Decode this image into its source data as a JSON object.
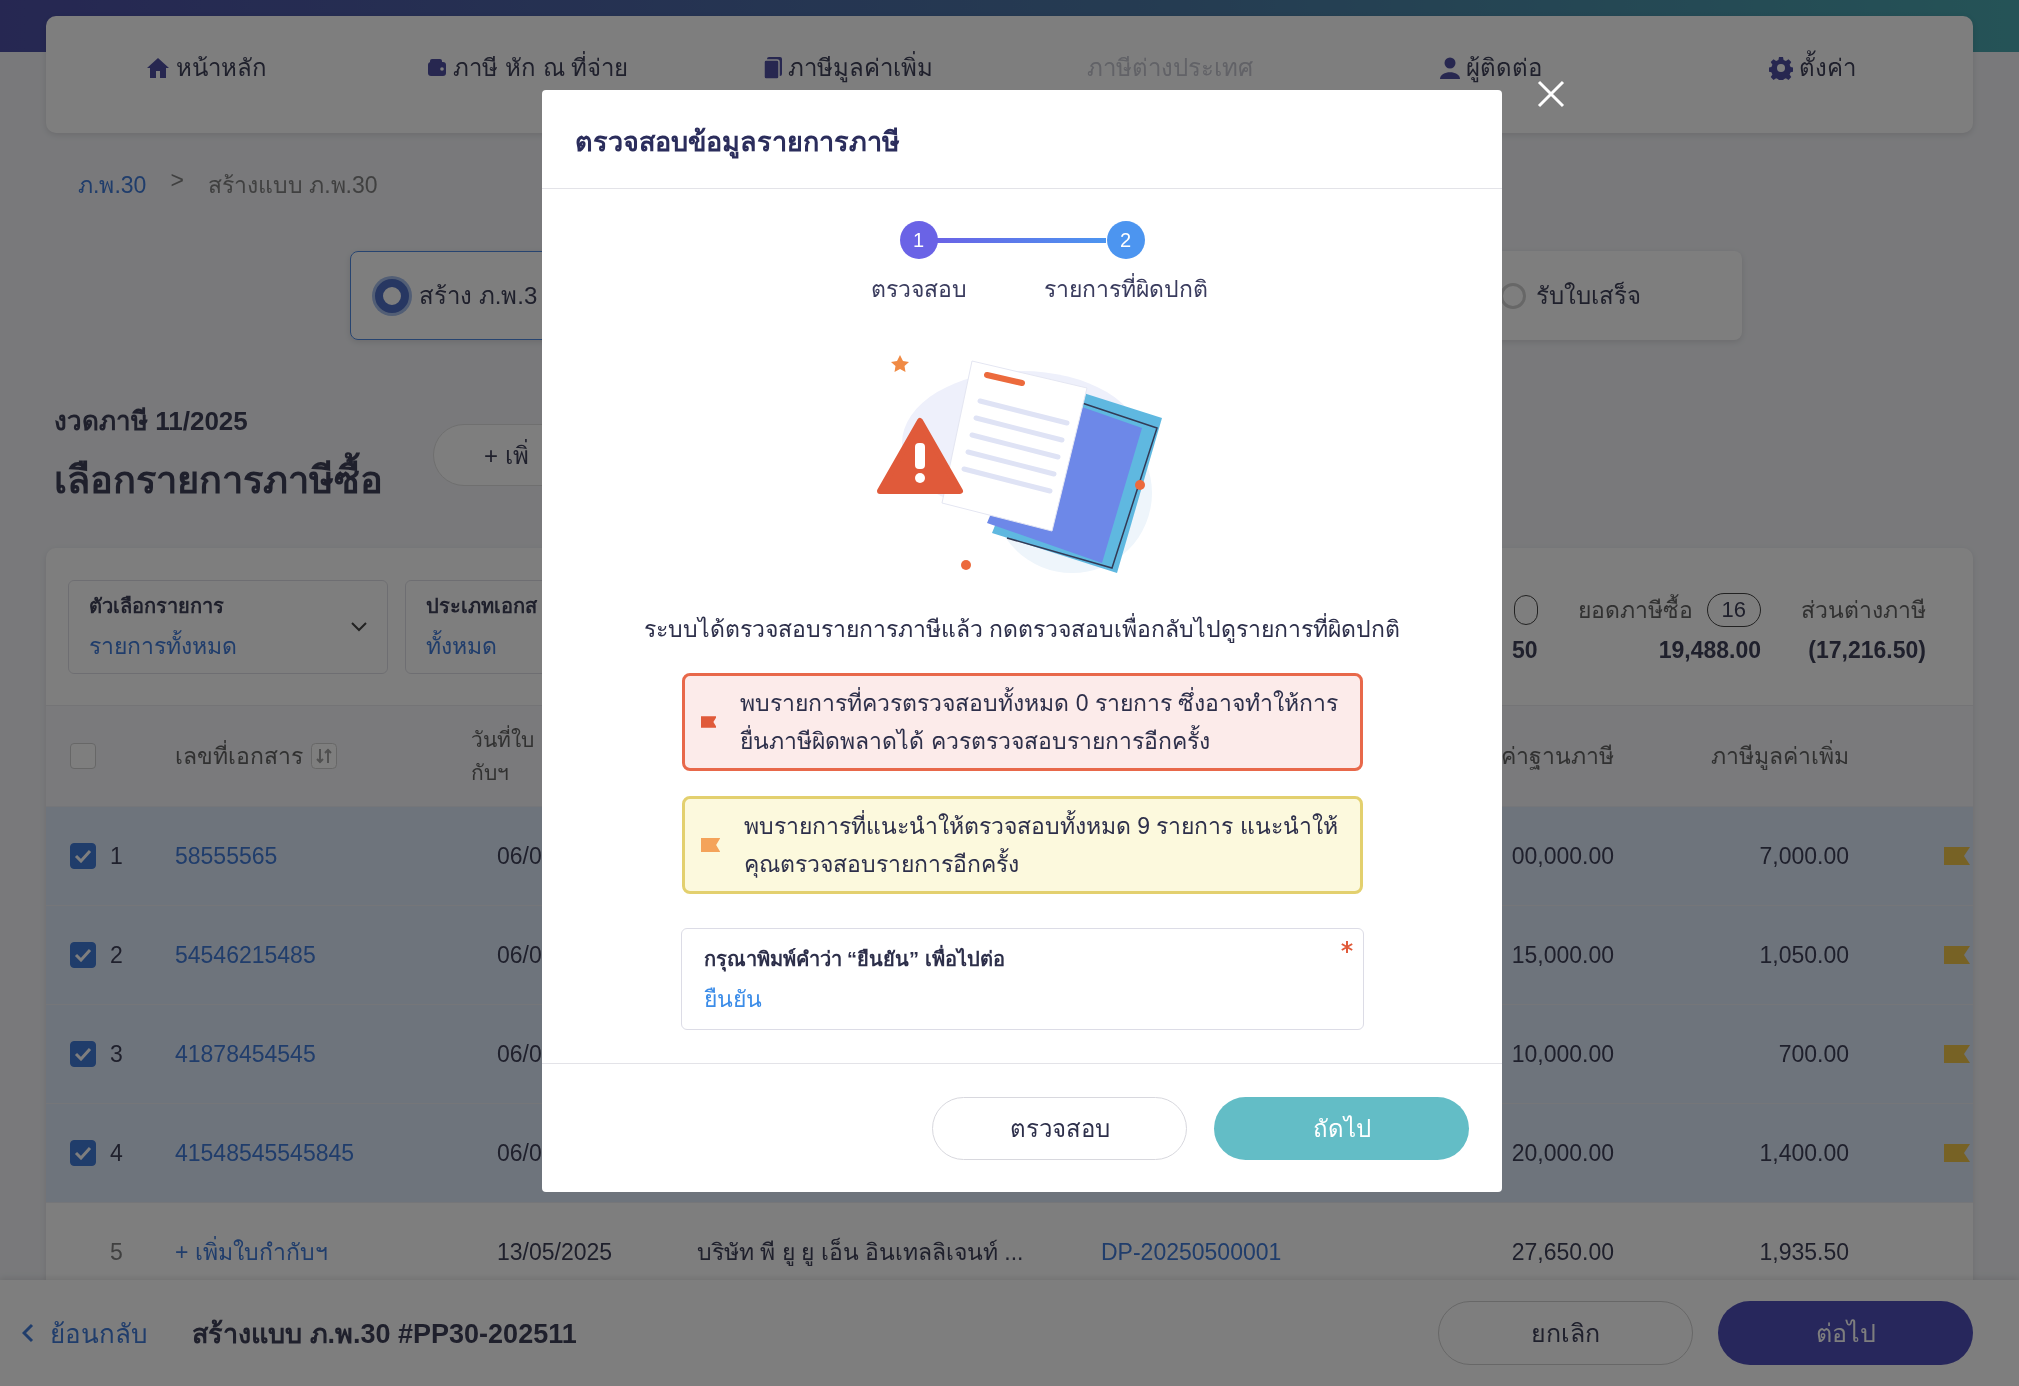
{
  "nav": [
    {
      "label": "หน้าหลัก",
      "kind": "home",
      "disabled": false
    },
    {
      "label": "ภาษี หัก ณ ที่จ่าย",
      "kind": "wallet",
      "disabled": false
    },
    {
      "label": "ภาษีมูลค่าเพิ่ม",
      "kind": "document",
      "disabled": false
    },
    {
      "label": "ภาษีต่างประเทศ",
      "kind": "none",
      "disabled": true
    },
    {
      "label": "ผู้ติดต่อ",
      "kind": "user",
      "disabled": false
    },
    {
      "label": "ตั้งค่า",
      "kind": "gear",
      "disabled": false
    }
  ],
  "breadcrumb": {
    "link": "ภ.พ.30",
    "separator": ">",
    "current": "สร้างแบบ ภ.พ.30"
  },
  "steps": [
    {
      "label": "สร้าง ภ.พ.3",
      "selected": true
    },
    {
      "label": "รับใบเสร็จ",
      "selected": false
    }
  ],
  "period": "งวดภาษี 11/2025",
  "heading": "เลือกรายการภาษีซื้อ",
  "add_button": "+ เพิ่",
  "filters": [
    {
      "label": "ตัวเลือกรายการ",
      "value": "รายการทั้งหมด",
      "kind": "select"
    },
    {
      "label": "ประเภทเอกส",
      "value": "ทั้งหมด",
      "kind": "text"
    }
  ],
  "summary": [
    {
      "value": "50",
      "badge": true
    },
    {
      "label": "ยอดภาษีซื้อ",
      "count": "16",
      "value": "19,488.00"
    },
    {
      "label": "ส่วนต่างภาษี",
      "value": "(17,216.50)"
    }
  ],
  "table": {
    "columns": [
      {
        "label": "เลขที่เอกสาร",
        "kind": "doc",
        "sortable": true
      },
      {
        "label": "วันที่ใบ กับฯ",
        "kind": "date",
        "sortable": false
      },
      {
        "label": "ค่าฐานภาษี",
        "kind": "base",
        "sortable": false
      },
      {
        "label": "ภาษีมูลค่าเพิ่ม",
        "kind": "vat",
        "sortable": false
      }
    ],
    "all_checked": false,
    "rows": [
      {
        "index": "1",
        "doc": "58555565",
        "date": "06/0",
        "base": "00,000.00",
        "vat": "7,000.00",
        "checked": true,
        "flag": true
      },
      {
        "index": "2",
        "doc": "54546215485",
        "date": "06/0",
        "base": "15,000.00",
        "vat": "1,050.00",
        "checked": true,
        "flag": true
      },
      {
        "index": "3",
        "doc": "41878454545",
        "date": "06/0",
        "base": "10,000.00",
        "vat": "700.00",
        "checked": true,
        "flag": true
      },
      {
        "index": "4",
        "doc": "41548545545845",
        "date": "06/0",
        "base": "20,000.00",
        "vat": "1,400.00",
        "checked": true,
        "flag": true
      },
      {
        "index": "5",
        "doc": "+ เพิ่มใบกำกับฯ",
        "date": "13/05/2025",
        "company": "บริษัท พี ยู ยู เอ็น อินเทลลิเจนท์ ...",
        "ref": "DP-20250500001",
        "base": "27,650.00",
        "vat": "1,935.50",
        "flag": false
      }
    ]
  },
  "footer": {
    "back": "ย้อนกลับ",
    "title": "สร้างแบบ ภ.พ.30 #PP30-202511",
    "cancel": "ยกเลิก",
    "next": "ต่อไป"
  },
  "modal": {
    "title": "ตรวจสอบข้อมูลรายการภาษี",
    "steps": [
      {
        "number": "1",
        "label": "ตรวจสอบ",
        "color": "#6a63e6"
      },
      {
        "number": "2",
        "label": "รายการที่ผิดปกติ",
        "color": "#4c95f0"
      }
    ],
    "message": "ระบบได้ตรวจสอบรายการภาษีแล้ว กดตรวจสอบเพื่อกลับไปดูรายการที่ผิดปกติ",
    "alerts": [
      {
        "kind": "error",
        "text": "พบรายการที่ควรตรวจสอบทั้งหมด 0 รายการ ซึ่งอาจทำให้การยื่นภาษีผิดพลาดได้ ควรตรวจสอบรายการอีกครั้ง"
      },
      {
        "kind": "warning",
        "text": "พบรายการที่แนะนำให้ตรวจสอบทั้งหมด 9 รายการ แนะนำให้คุณตรวจสอบรายการอีกครั้ง"
      }
    ],
    "field": {
      "label": "กรุณาพิมพ์คำว่า “ยืนยัน” เพื่อไปต่อ",
      "value": "ยืนยัน",
      "required": true
    },
    "buttons": [
      {
        "label": "ตรวจสอบ",
        "kind": "secondary"
      },
      {
        "label": "ถัดไป",
        "kind": "primary"
      }
    ]
  }
}
